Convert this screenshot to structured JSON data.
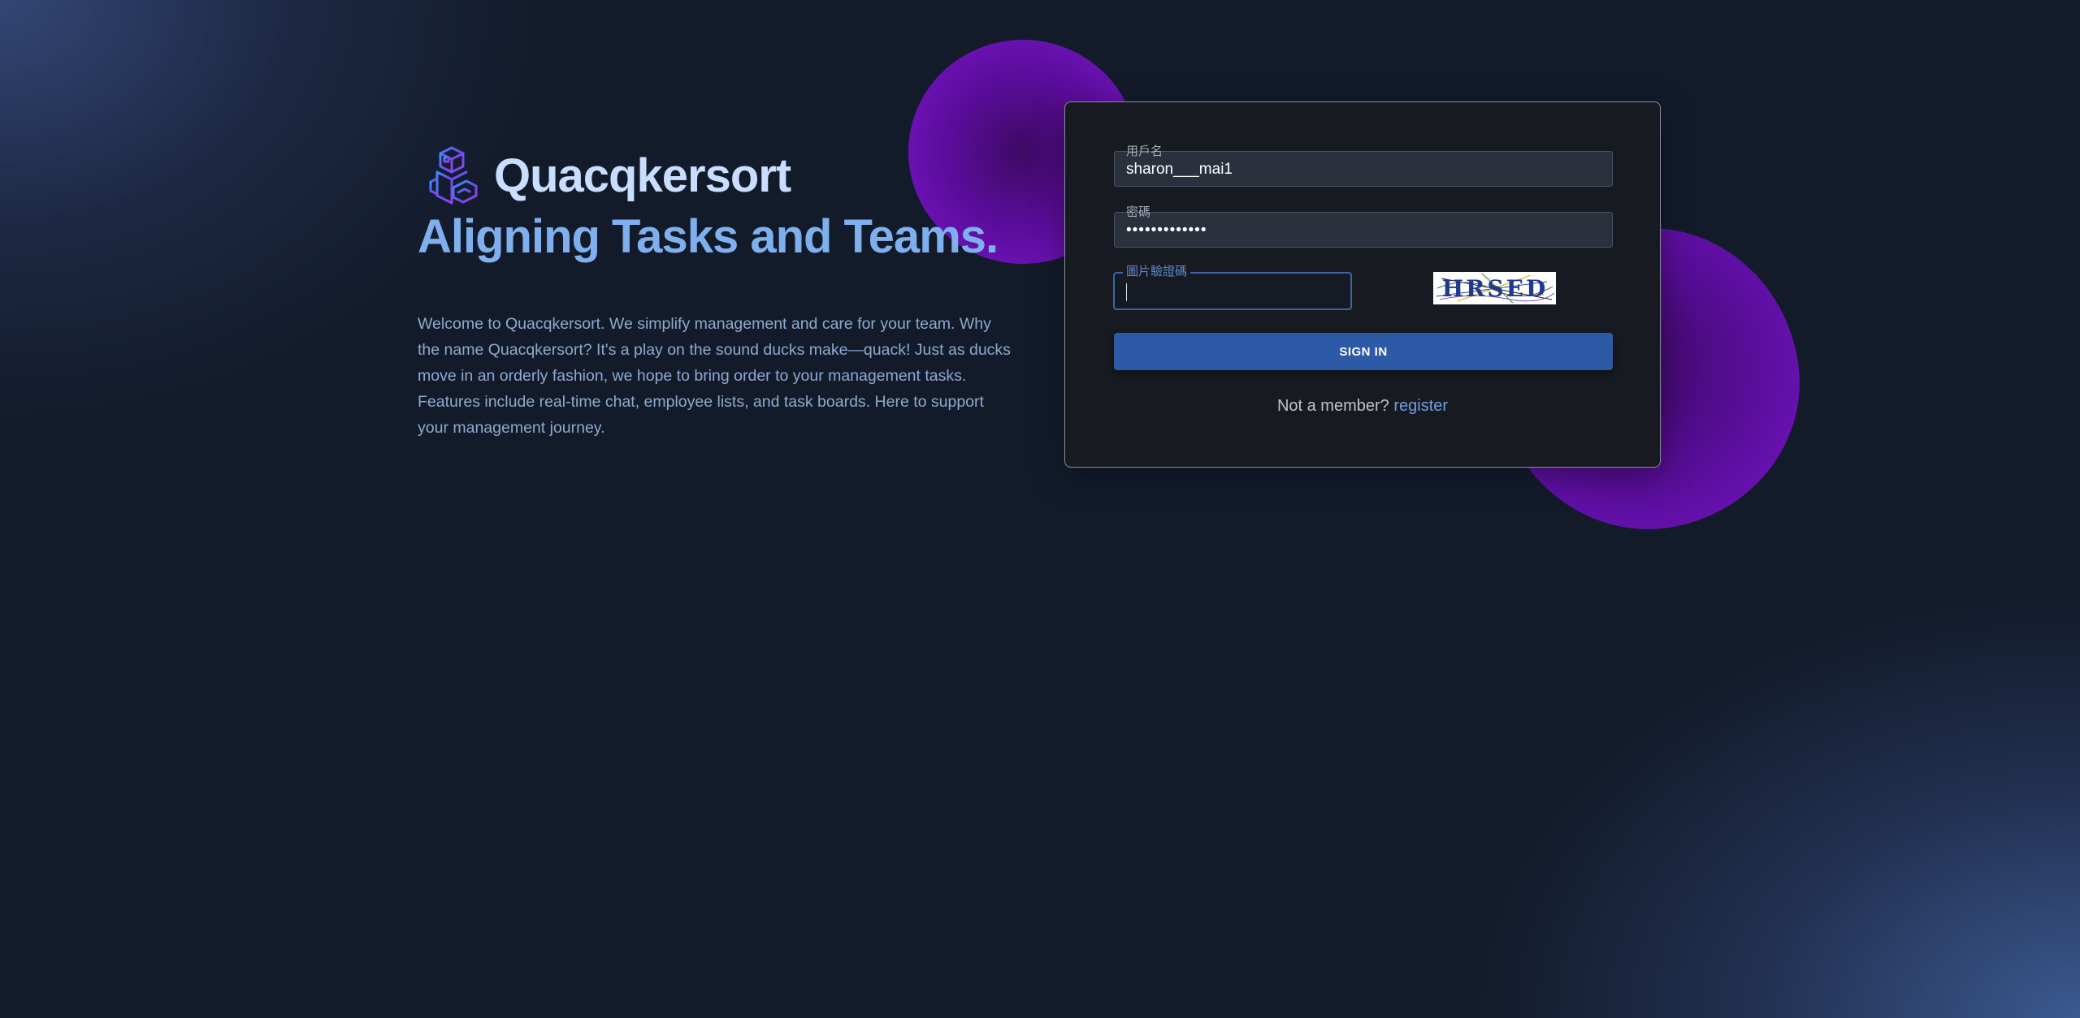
{
  "brand": {
    "name": "Quacqkersort",
    "tagline": "Aligning Tasks and Teams.",
    "intro": "Welcome to Quacqkersort. We simplify management and care for your team. Why the name Quacqkersort? It's a play on the sound ducks make—quack! Just as ducks move in an orderly fashion, we hope to bring order to your management tasks. Features include real-time chat, employee lists, and task boards. Here to support your management journey.",
    "logo_icon": "robot-duck-icon"
  },
  "login": {
    "username_label": "用戶名",
    "username_value": "sharon___mai1",
    "password_label": "密碼",
    "password_value": "•••••••••••••",
    "captcha_label": "圖片驗證碼",
    "captcha_value": "",
    "captcha_text": "HRSED",
    "signin_label": "SIGN IN",
    "member_prompt": "Not a member?",
    "register_label": "register"
  },
  "colors": {
    "background": "#131b2b",
    "accent": "#2c5aa6",
    "blob": "#6e14bb",
    "link": "#6f9fe0",
    "brand_title": "#c9ddff",
    "tagline": "#7fb0ee"
  }
}
